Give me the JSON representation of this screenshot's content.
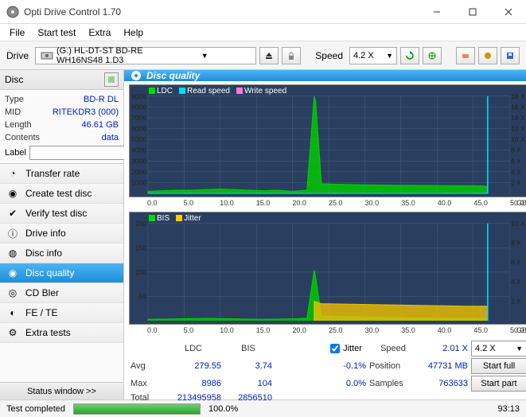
{
  "title": "Opti Drive Control 1.70",
  "menu": [
    "File",
    "Start test",
    "Extra",
    "Help"
  ],
  "toolbar": {
    "drive_lbl": "Drive",
    "drive_text": "(G:)   HL-DT-ST BD-RE  WH16NS48 1.D3",
    "speed_lbl": "Speed",
    "speed_val": "4.2 X"
  },
  "disc": {
    "hdr": "Disc",
    "type_k": "Type",
    "type_v": "BD-R DL",
    "mid_k": "MID",
    "mid_v": "RITEKDR3 (000)",
    "len_k": "Length",
    "len_v": "46.61 GB",
    "cont_k": "Contents",
    "cont_v": "data",
    "label_k": "Label"
  },
  "nav": [
    "Transfer rate",
    "Create test disc",
    "Verify test disc",
    "Drive info",
    "Disc info",
    "Disc quality",
    "CD Bler",
    "FE / TE",
    "Extra tests"
  ],
  "status_window": "Status window >>",
  "content_title": "Disc quality",
  "chart1_legend": [
    "LDC",
    "Read speed",
    "Write speed"
  ],
  "chart2_legend": [
    "BIS",
    "Jitter"
  ],
  "axis_x_unit": "GB",
  "stats": {
    "col_ldc": "LDC",
    "col_bis": "BIS",
    "jitter_lbl": "Jitter",
    "speed_lbl": "Speed",
    "speed_val": "2.01 X",
    "speed_combo": "4.2 X",
    "avg_lbl": "Avg",
    "avg_ldc": "279.55",
    "avg_bis": "3.74",
    "avg_jit": "-0.1%",
    "pos_lbl": "Position",
    "pos_val": "47731 MB",
    "start_full": "Start full",
    "max_lbl": "Max",
    "max_ldc": "8986",
    "max_bis": "104",
    "max_jit": "0.0%",
    "samp_lbl": "Samples",
    "samp_val": "763633",
    "start_part": "Start part",
    "tot_lbl": "Total",
    "tot_ldc": "213495958",
    "tot_bis": "2856510"
  },
  "statusbar": {
    "msg": "Test completed",
    "pct": "100.0%",
    "time": "93:13"
  },
  "chart_data": [
    {
      "type": "line",
      "title": "LDC / Read speed",
      "xlabel": "GB",
      "ylabel_left": "LDC",
      "ylabel_right": "Speed X",
      "xlim": [
        0,
        50
      ],
      "ylim_left": [
        0,
        9000
      ],
      "ylim_right": [
        0,
        18
      ],
      "x_ticks": [
        0,
        5,
        10,
        15,
        20,
        25,
        30,
        35,
        40,
        45,
        50
      ],
      "y_ticks_left": [
        1000,
        2000,
        3000,
        4000,
        5000,
        6000,
        7000,
        8000,
        9000
      ],
      "y_ticks_right": [
        2,
        4,
        6,
        8,
        10,
        12,
        14,
        16,
        18
      ],
      "series": [
        {
          "name": "LDC",
          "color": "#00d000",
          "x": [
            0,
            2,
            4,
            6,
            8,
            10,
            12,
            14,
            16,
            18,
            20,
            22,
            23,
            23.2,
            24,
            26,
            28,
            30,
            32,
            34,
            36,
            38,
            40,
            42,
            44,
            46,
            47
          ],
          "values": [
            200,
            250,
            300,
            300,
            350,
            400,
            350,
            300,
            250,
            300,
            200,
            300,
            8986,
            8500,
            900,
            850,
            820,
            800,
            780,
            760,
            750,
            740,
            730,
            720,
            710,
            700,
            650
          ]
        },
        {
          "name": "Read speed",
          "color": "#00e0ff",
          "x": [
            0,
            47,
            47.01
          ],
          "values": [
            2,
            2,
            18
          ]
        }
      ]
    },
    {
      "type": "line",
      "title": "BIS / Jitter",
      "xlabel": "GB",
      "ylabel_left": "BIS",
      "ylabel_right": "Jitter %",
      "xlim": [
        0,
        50
      ],
      "ylim_left": [
        0,
        200
      ],
      "ylim_right": [
        0,
        10
      ],
      "x_ticks": [
        0,
        5,
        10,
        15,
        20,
        25,
        30,
        35,
        40,
        45,
        50
      ],
      "y_ticks_left": [
        50,
        100,
        150,
        200
      ],
      "y_ticks_right": [
        2,
        4,
        6,
        8,
        10
      ],
      "series": [
        {
          "name": "BIS",
          "color": "#00d000",
          "x": [
            0,
            4,
            8,
            12,
            16,
            20,
            22,
            23,
            23.2,
            24,
            28,
            32,
            36,
            40,
            44,
            47
          ],
          "values": [
            3,
            4,
            5,
            4,
            3,
            4,
            5,
            104,
            90,
            10,
            8,
            7,
            6,
            6,
            5,
            5
          ]
        },
        {
          "name": "Jitter",
          "color": "#f0c000",
          "x": [
            23,
            24,
            28,
            32,
            36,
            40,
            44,
            47
          ],
          "values": [
            40,
            35,
            34,
            33,
            32,
            31,
            30,
            30
          ]
        }
      ]
    }
  ]
}
